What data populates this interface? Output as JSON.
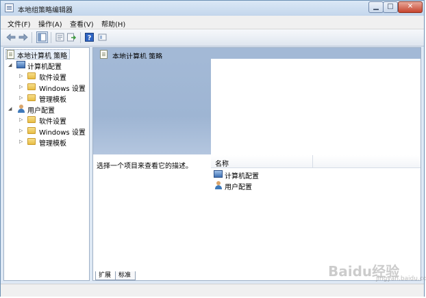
{
  "window": {
    "title": "本地组策略编辑器"
  },
  "controls": {
    "minimize": "▁",
    "maximize": "□",
    "close": "✕"
  },
  "menu": {
    "items": [
      "文件(F)",
      "操作(A)",
      "查看(V)",
      "帮助(H)"
    ]
  },
  "toolbar": {
    "icons": [
      "back-arrow-icon",
      "forward-arrow-icon",
      "show-hide-tree-icon",
      "properties-icon",
      "export-icon",
      "help-icon",
      "view-icon"
    ]
  },
  "tree": {
    "root": "本地计算机 策略",
    "computer_config": "计算机配置",
    "computer_children": [
      "软件设置",
      "Windows 设置",
      "管理模板"
    ],
    "user_config": "用户配置",
    "user_children": [
      "软件设置",
      "Windows 设置",
      "管理模板"
    ]
  },
  "right": {
    "header": "本地计算机 策略",
    "description": "选择一个项目来查看它的描述。",
    "column_name": "名称",
    "items": [
      "计算机配置",
      "用户配置"
    ]
  },
  "tabs": [
    "扩展",
    "标准"
  ],
  "watermark": {
    "brand": "Baidu经验",
    "url": "jingyan.baidu.com"
  }
}
